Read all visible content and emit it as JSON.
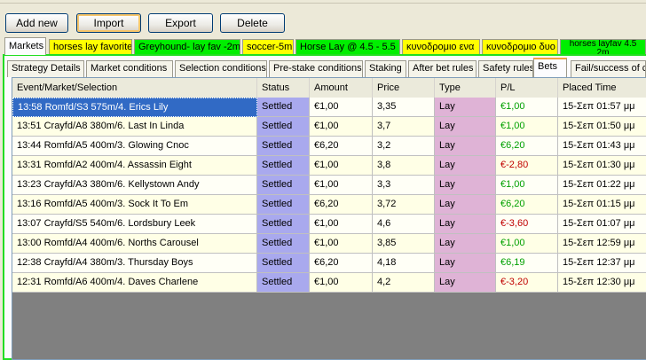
{
  "toolbar": {
    "add_new": "Add new",
    "import": "Import",
    "export": "Export",
    "delete": "Delete"
  },
  "strategy_tabs": [
    {
      "label": "Markets",
      "color": "#fcfcfe"
    },
    {
      "label": "horses lay favorite",
      "color": "#ffff00"
    },
    {
      "label": "Greyhound- lay fav -2m",
      "color": "#00ee00"
    },
    {
      "label": "soccer-5m",
      "color": "#ffff00"
    },
    {
      "label": "Horse Lay  @ 4.5 - 5.5",
      "color": "#00ee00"
    },
    {
      "label": "κυνοδρομιο ενα",
      "color": "#ffff00"
    },
    {
      "label": "κυνοδρομιο δυο",
      "color": "#ffff00"
    },
    {
      "label": "horses layfav 4.5",
      "label2": "2m",
      "color": "#00ee00"
    }
  ],
  "detail_tabs": [
    "Strategy Details",
    "Market conditions",
    "Selection conditions",
    "Pre-stake conditions",
    "Staking",
    "After bet rules",
    "Safety rules",
    "Bets",
    "Fail/success of co"
  ],
  "active_detail_tab": "Bets",
  "bets": {
    "columns": [
      "Event/Market/Selection",
      "Status",
      "Amount",
      "Price",
      "Type",
      "P/L",
      "Placed Time"
    ],
    "rows": [
      {
        "event": "13:58 Romfd/S3 575m/4. Erics Lily",
        "status": "Settled",
        "amount": "€1,00",
        "price": "3,35",
        "type": "Lay",
        "pl": "€1,00",
        "pl_sign": "pos",
        "time": "15-Σεπ 01:57 μμ"
      },
      {
        "event": "13:51 Crayfd/A8 380m/6. Last In Linda",
        "status": "Settled",
        "amount": "€1,00",
        "price": "3,7",
        "type": "Lay",
        "pl": "€1,00",
        "pl_sign": "pos",
        "time": "15-Σεπ 01:50 μμ"
      },
      {
        "event": "13:44 Romfd/A5 400m/3. Glowing Cnoc",
        "status": "Settled",
        "amount": "€6,20",
        "price": "3,2",
        "type": "Lay",
        "pl": "€6,20",
        "pl_sign": "pos",
        "time": "15-Σεπ 01:43 μμ"
      },
      {
        "event": "13:31 Romfd/A2 400m/4. Assassin Eight",
        "status": "Settled",
        "amount": "€1,00",
        "price": "3,8",
        "type": "Lay",
        "pl": "€-2,80",
        "pl_sign": "neg",
        "time": "15-Σεπ 01:30 μμ"
      },
      {
        "event": "13:23 Crayfd/A3 380m/6. Kellystown Andy",
        "status": "Settled",
        "amount": "€1,00",
        "price": "3,3",
        "type": "Lay",
        "pl": "€1,00",
        "pl_sign": "pos",
        "time": "15-Σεπ 01:22 μμ"
      },
      {
        "event": "13:16 Romfd/A5 400m/3. Sock It To Em",
        "status": "Settled",
        "amount": "€6,20",
        "price": "3,72",
        "type": "Lay",
        "pl": "€6,20",
        "pl_sign": "pos",
        "time": "15-Σεπ 01:15 μμ"
      },
      {
        "event": "13:07 Crayfd/S5 540m/6. Lordsbury Leek",
        "status": "Settled",
        "amount": "€1,00",
        "price": "4,6",
        "type": "Lay",
        "pl": "€-3,60",
        "pl_sign": "neg",
        "time": "15-Σεπ 01:07 μμ"
      },
      {
        "event": "13:00 Romfd/A4 400m/6. Norths Carousel",
        "status": "Settled",
        "amount": "€1,00",
        "price": "3,85",
        "type": "Lay",
        "pl": "€1,00",
        "pl_sign": "pos",
        "time": "15-Σεπ 12:59 μμ"
      },
      {
        "event": "12:38 Crayfd/A4 380m/3. Thursday Boys",
        "status": "Settled",
        "amount": "€6,20",
        "price": "4,18",
        "type": "Lay",
        "pl": "€6,19",
        "pl_sign": "pos",
        "time": "15-Σεπ 12:37 μμ"
      },
      {
        "event": "12:31 Romfd/A6 400m/4. Daves Charlene",
        "status": "Settled",
        "amount": "€1,00",
        "price": "4,2",
        "type": "Lay",
        "pl": "€-3,20",
        "pl_sign": "neg",
        "time": "15-Σεπ 12:30 μμ"
      }
    ]
  }
}
